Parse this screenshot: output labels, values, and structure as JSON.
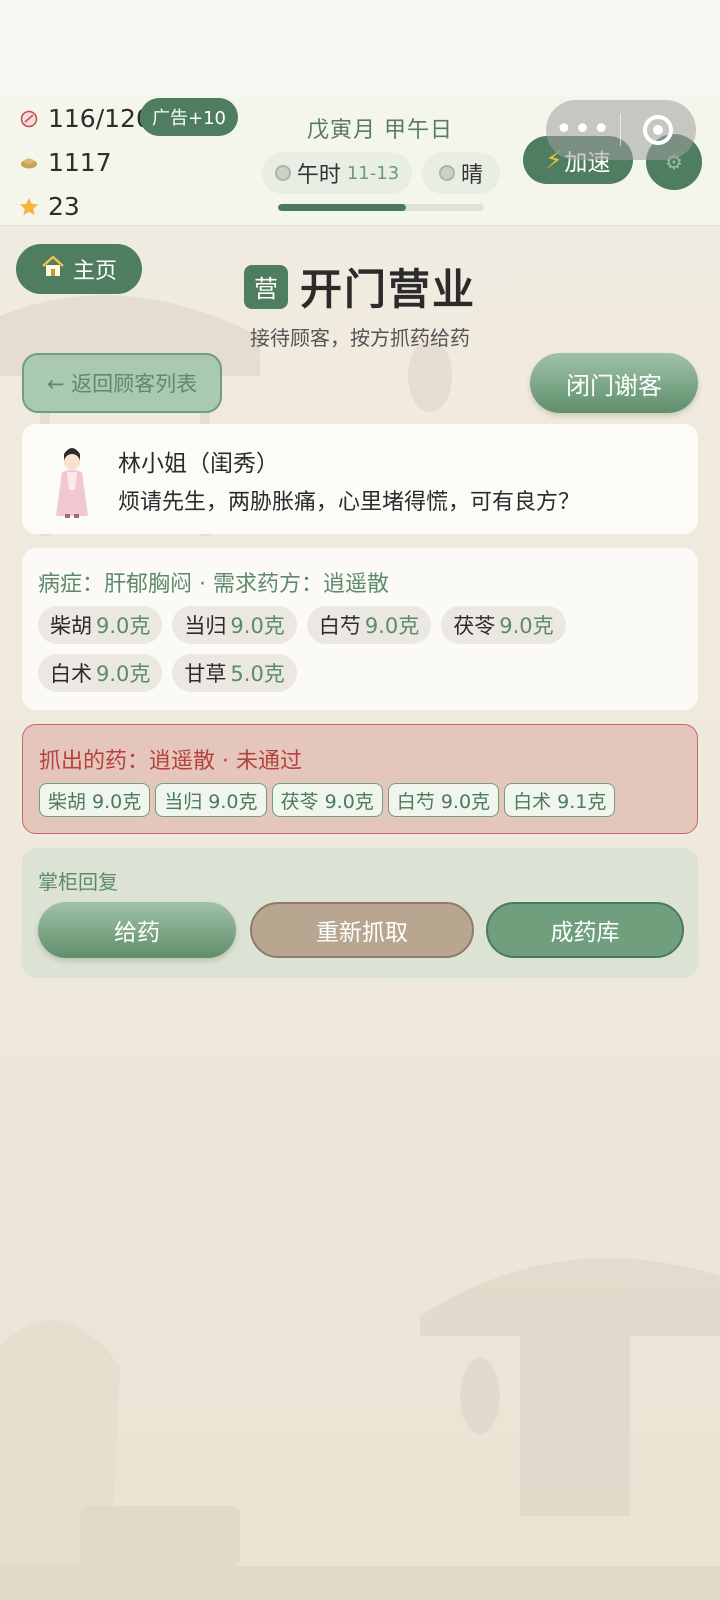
{
  "hud": {
    "stamina": "116/120",
    "ad_button": "广告+10",
    "coins": "1117",
    "stars": "23",
    "date": "戊寅月 甲午日",
    "time_period": "午时",
    "time_range": "11-13",
    "weather": "晴",
    "day_progress": 0.62,
    "speed_button": "加速"
  },
  "nav": {
    "home_button": "主页",
    "title_badge": "营",
    "title": "开门营业",
    "subtitle": "接待顾客，按方抓药给药",
    "back_button": "← 返回顾客列表",
    "close_shop_button": "闭门谢客"
  },
  "customer": {
    "name": "林小姐（闺秀）",
    "line": "烦请先生，两胁胀痛，心里堵得慌，可有良方？"
  },
  "prescription": {
    "header": "病症：肝郁胸闷 · 需求药方：逍遥散",
    "herbs": [
      {
        "name": "柴胡",
        "weight": "9.0克"
      },
      {
        "name": "当归",
        "weight": "9.0克"
      },
      {
        "name": "白芍",
        "weight": "9.0克"
      },
      {
        "name": "茯苓",
        "weight": "9.0克"
      },
      {
        "name": "白术",
        "weight": "9.0克"
      },
      {
        "name": "甘草",
        "weight": "5.0克"
      }
    ]
  },
  "picked": {
    "header": "抓出的药：逍遥散 · 未通过",
    "herbs": [
      "柴胡 9.0克",
      "当归 9.0克",
      "茯苓 9.0克",
      "白芍 9.0克",
      "白术 9.1克"
    ]
  },
  "reply": {
    "label": "掌柜回复",
    "give_button": "给药",
    "repick_button": "重新抓取",
    "stock_button": "成药库"
  },
  "colors": {
    "primary_green": "#4f7d5f",
    "fail_red": "#b5433c",
    "accent_gold": "#f2c232"
  }
}
